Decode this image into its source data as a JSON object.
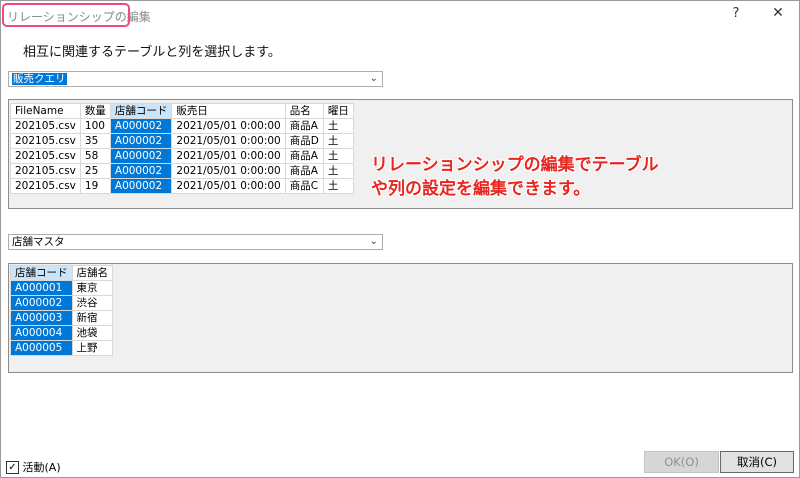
{
  "window": {
    "title": "リレーションシップの編集",
    "help": "?",
    "close": "✕"
  },
  "instruction": "相互に関連するテーブルと列を選択します。",
  "table1": {
    "selected": "販売クエリ",
    "columns": [
      "FileName",
      "数量",
      "店舗コード",
      "販売日",
      "品名",
      "曜日"
    ],
    "highlight_col": 2,
    "rows": [
      [
        "202105.csv",
        "100",
        "A000002",
        "2021/05/01 0:00:00",
        "商品A",
        "土"
      ],
      [
        "202105.csv",
        "35",
        "A000002",
        "2021/05/01 0:00:00",
        "商品D",
        "土"
      ],
      [
        "202105.csv",
        "58",
        "A000002",
        "2021/05/01 0:00:00",
        "商品A",
        "土"
      ],
      [
        "202105.csv",
        "25",
        "A000002",
        "2021/05/01 0:00:00",
        "商品A",
        "土"
      ],
      [
        "202105.csv",
        "19",
        "A000002",
        "2021/05/01 0:00:00",
        "商品C",
        "土"
      ]
    ]
  },
  "annotation": {
    "line1": "リレーションシップの編集でテーブル",
    "line2": "や列の設定を編集できます。"
  },
  "table2": {
    "selected": "店舗マスタ",
    "columns": [
      "店舗コード",
      "店舗名"
    ],
    "highlight_col": 0,
    "rows": [
      [
        "A000001",
        "東京"
      ],
      [
        "A000002",
        "渋谷"
      ],
      [
        "A000003",
        "新宿"
      ],
      [
        "A000004",
        "池袋"
      ],
      [
        "A000005",
        "上野"
      ]
    ]
  },
  "footer": {
    "active_label": "活動(A)",
    "active_checked": true,
    "ok_label": "OK(O)",
    "cancel_label": "取消(C)"
  },
  "colors": {
    "accent": "#0078d7",
    "annotation": "#e8261f",
    "title_highlight": "#f0488b"
  }
}
